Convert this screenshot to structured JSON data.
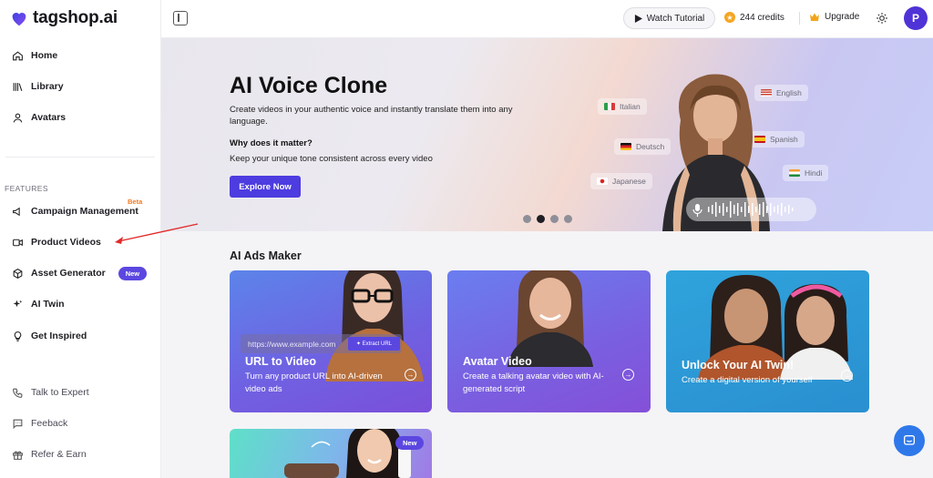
{
  "app": {
    "logo_text": "tagshop.ai"
  },
  "sidebar": {
    "main_items": [
      {
        "label": "Home",
        "icon": "home-icon"
      },
      {
        "label": "Library",
        "icon": "library-icon"
      },
      {
        "label": "Avatars",
        "icon": "user-icon"
      }
    ],
    "section_label": "FEATURES",
    "feature_items": [
      {
        "label": "Campaign Management",
        "icon": "megaphone-icon",
        "badge": "Beta"
      },
      {
        "label": "Product Videos",
        "icon": "video-icon"
      },
      {
        "label": "Asset Generator",
        "icon": "cube-icon",
        "badge": "New"
      },
      {
        "label": "AI Twin",
        "icon": "sparkle-icon"
      },
      {
        "label": "Get Inspired",
        "icon": "lightbulb-icon"
      }
    ],
    "bottom_items": [
      {
        "label": "Talk to Expert",
        "icon": "phone-icon"
      },
      {
        "label": "Feeback",
        "icon": "chat-icon"
      },
      {
        "label": "Refer & Earn",
        "icon": "gift-icon"
      }
    ]
  },
  "topbar": {
    "watch_label": "Watch Tutorial",
    "credits_label": "244 credits",
    "upgrade_label": "Upgrade",
    "avatar_initial": "P"
  },
  "hero": {
    "title": "AI Voice Clone",
    "description": "Create videos in your authentic voice and instantly translate them into any language.",
    "question": "Why does it matter?",
    "subtext": "Keep your unique tone consistent across every video",
    "cta": "Explore Now",
    "languages": [
      "Italian",
      "English",
      "Deutsch",
      "Spanish",
      "Hindi",
      "Japanese"
    ],
    "active_slide": 2,
    "slide_count": 4
  },
  "ads": {
    "title": "AI Ads Maker",
    "cards": [
      {
        "title": "URL to Video",
        "desc": "Turn any product URL into AI-driven video ads",
        "url_placeholder": "https://www.example.com",
        "extract_label": "Extract URL"
      },
      {
        "title": "Avatar Video",
        "desc": "Create a talking avatar video with AI-generated script"
      },
      {
        "title": "Unlock Your AI Twin!",
        "desc": "Create a digital version of yourself"
      },
      {
        "badge": "New"
      }
    ]
  },
  "colors": {
    "accent": "#4d3ce0",
    "beta": "#f07a1f",
    "chat": "#2f78ea"
  }
}
